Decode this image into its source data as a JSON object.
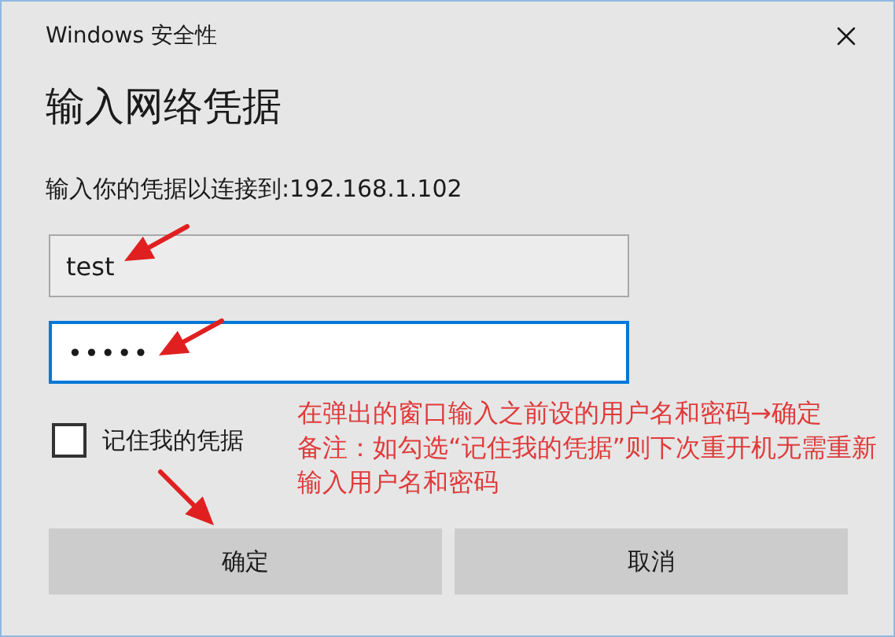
{
  "window": {
    "title": "Windows 安全性"
  },
  "heading": "输入网络凭据",
  "prompt": "输入你的凭据以连接到:192.168.1.102",
  "fields": [
    {
      "kind": "text",
      "value": "test",
      "focused": false
    },
    {
      "kind": "password",
      "value": "•••••",
      "focused": true
    }
  ],
  "remember": {
    "label": "记住我的凭据",
    "checked": false
  },
  "buttons": [
    {
      "label": "确定"
    },
    {
      "label": "取消"
    }
  ],
  "annotations": [
    "在弹出的窗口输入之前设的用户名和密码→确定",
    "备注：如勾选“记住我的凭据”则下次重开机无需重新输入用户名和密码"
  ]
}
